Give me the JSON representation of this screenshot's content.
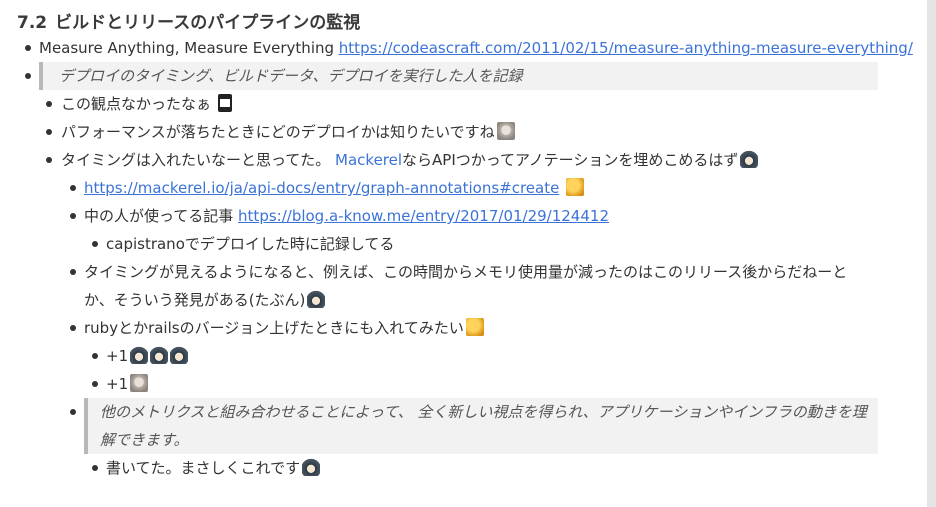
{
  "section": {
    "number": "7.2",
    "title": "ビルドとリリースのパイプラインの監視"
  },
  "items": {
    "measure_text": "Measure Anything, Measure Everything",
    "measure_link": "https://codeascraft.com/2011/02/15/measure-anything-measure-everything/",
    "quote1": "デプロイのタイミング、ビルドデータ、デプロイを実行した人を記録",
    "c1": "この観点なかったなぁ",
    "c2": "パフォーマンスが落ちたときにどのデプロイかは知りたいですね",
    "c3_pre": "タイミングは入れたいなーと思ってた。",
    "c3_link": "Mackerel",
    "c3_post": "ならAPIつかってアノテーションを埋めこめるはず",
    "c3a_link": "https://mackerel.io/ja/api-docs/entry/graph-annotations#create",
    "c3b_pre": "中の人が使ってる記事",
    "c3b_link": "https://blog.a-know.me/entry/2017/01/29/124412",
    "c3b1": "capistranoでデプロイした時に記録してる",
    "c3c_line1": "タイミングが見えるようになると、例えば、この時間からメモリ使用量が減ったのはこのリリース後からだねーと",
    "c3c_line2": "か、そういう発見がある(たぶん)",
    "c3d": "rubyとかrailsのバージョン上げたときにも入れてみたい",
    "plus1a": "+1",
    "plus1b": "+1",
    "quote2_line1": "他のメトリクスと組み合わせることによって、 全く新しい視点を得られ、アプリケーションやインフラの動きを理",
    "quote2_line2": "解できます。",
    "c3e1": "書いてた。まさしくこれです"
  },
  "icons": [
    "hourglass-icon",
    "avatar-face-icon",
    "avatar-character-icon",
    "duck-icon"
  ]
}
